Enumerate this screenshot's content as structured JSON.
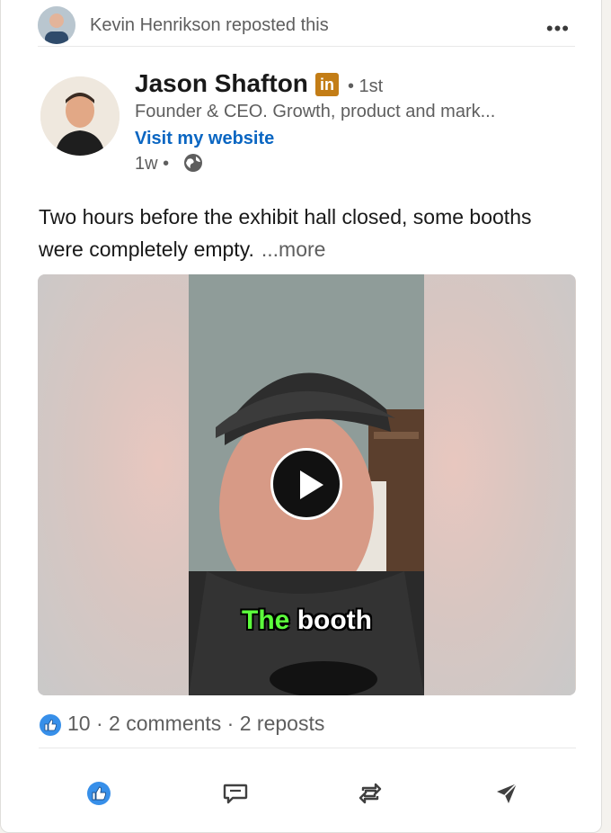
{
  "repost": {
    "text": "Kevin Henrikson reposted this",
    "menu_icon": "ellipsis-icon"
  },
  "author": {
    "name": "Jason Shafton",
    "badge": "in",
    "degree": "• 1st",
    "headline": "Founder & CEO. Growth, product and mark...",
    "website_link": "Visit my website",
    "posted": "1w •",
    "visibility_icon": "globe-icon"
  },
  "post": {
    "text": "Two hours before the exhibit hall closed, some booths were completely empty.",
    "more_label": "...more"
  },
  "video": {
    "caption_highlight": "The",
    "caption_rest": "booth",
    "caption_highlight_color": "#5cff3c",
    "play_icon": "play-icon"
  },
  "social": {
    "reaction_icon": "like-reaction-icon",
    "summary": "10 · 2 comments · 2 reposts"
  },
  "actions": [
    {
      "icon": "like-icon"
    },
    {
      "icon": "comment-icon"
    },
    {
      "icon": "repost-icon"
    },
    {
      "icon": "send-icon"
    }
  ],
  "colors": {
    "accent": "#0a66c2",
    "badge": "#c37d16"
  }
}
